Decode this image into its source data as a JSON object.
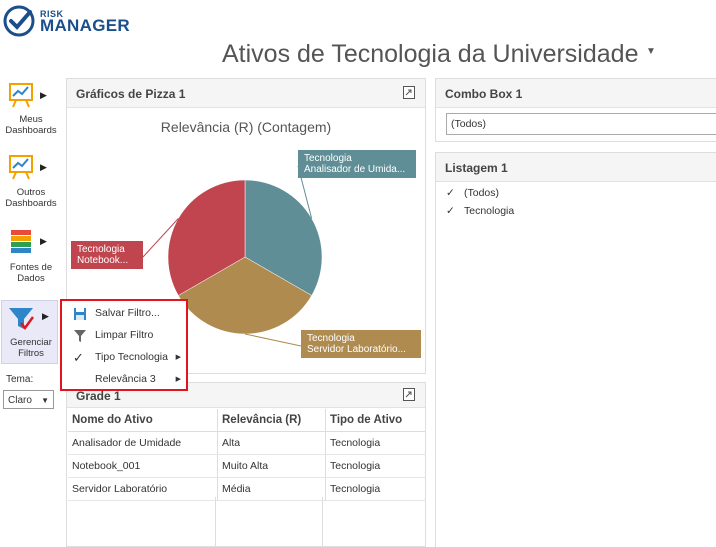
{
  "logo": {
    "line1": "RISK",
    "line2": "MANAGER"
  },
  "page": {
    "title": "Ativos de Tecnologia da Universidade"
  },
  "sidebar": {
    "items": [
      {
        "line1": "Meus",
        "line2": "Dashboards",
        "icon": "easel-chart-icon"
      },
      {
        "line1": "Outros",
        "line2": "Dashboards",
        "icon": "easel-chart-icon"
      },
      {
        "line1": "Fontes de",
        "line2": "Dados",
        "icon": "stacked-books-icon"
      },
      {
        "line1": "Gerenciar",
        "line2": "Filtros",
        "icon": "funnel-check-icon"
      }
    ],
    "tema_label": "Tema:",
    "tema_value": "Claro"
  },
  "pie_panel": {
    "title": "Gráficos de Pizza 1",
    "chart_data": {
      "type": "pie",
      "title": "Relevância (R) (Contagem)",
      "slices": [
        {
          "label_line1": "Tecnologia",
          "label_line2": "Analisador de Umida...",
          "value": 1,
          "color": "#5f8e96"
        },
        {
          "label_line1": "Tecnologia",
          "label_line2": "Servidor Laboratório...",
          "value": 1,
          "color": "#b08b4f"
        },
        {
          "label_line1": "Tecnologia",
          "label_line2": "Notebook...",
          "value": 1,
          "color": "#c0454e"
        }
      ]
    }
  },
  "grid_panel": {
    "title": "Grade 1",
    "columns": [
      "Nome do Ativo",
      "Relevância (R)",
      "Tipo de Ativo"
    ],
    "rows": [
      [
        "Analisador de Umidade",
        "Alta",
        "Tecnologia"
      ],
      [
        "Notebook_001",
        "Muito Alta",
        "Tecnologia"
      ],
      [
        "Servidor Laboratório",
        "Média",
        "Tecnologia"
      ]
    ]
  },
  "combo_panel": {
    "title": "Combo Box 1",
    "value": "(Todos)"
  },
  "list_panel": {
    "title": "Listagem 1",
    "items": [
      "(Todos)",
      "Tecnologia"
    ]
  },
  "context_menu": {
    "items": [
      {
        "label": "Salvar Filtro...",
        "icon": "floppy-disk-icon",
        "submenu": false
      },
      {
        "label": "Limpar Filtro",
        "icon": "funnel-icon",
        "submenu": false
      },
      {
        "label": "Tipo Tecnologia",
        "icon": "checkmark-icon",
        "submenu": true
      },
      {
        "label": "Relevância 3",
        "icon": "",
        "submenu": true
      }
    ]
  },
  "colors": {
    "brand": "#1a4f8a",
    "menu_border": "#e0161e"
  }
}
